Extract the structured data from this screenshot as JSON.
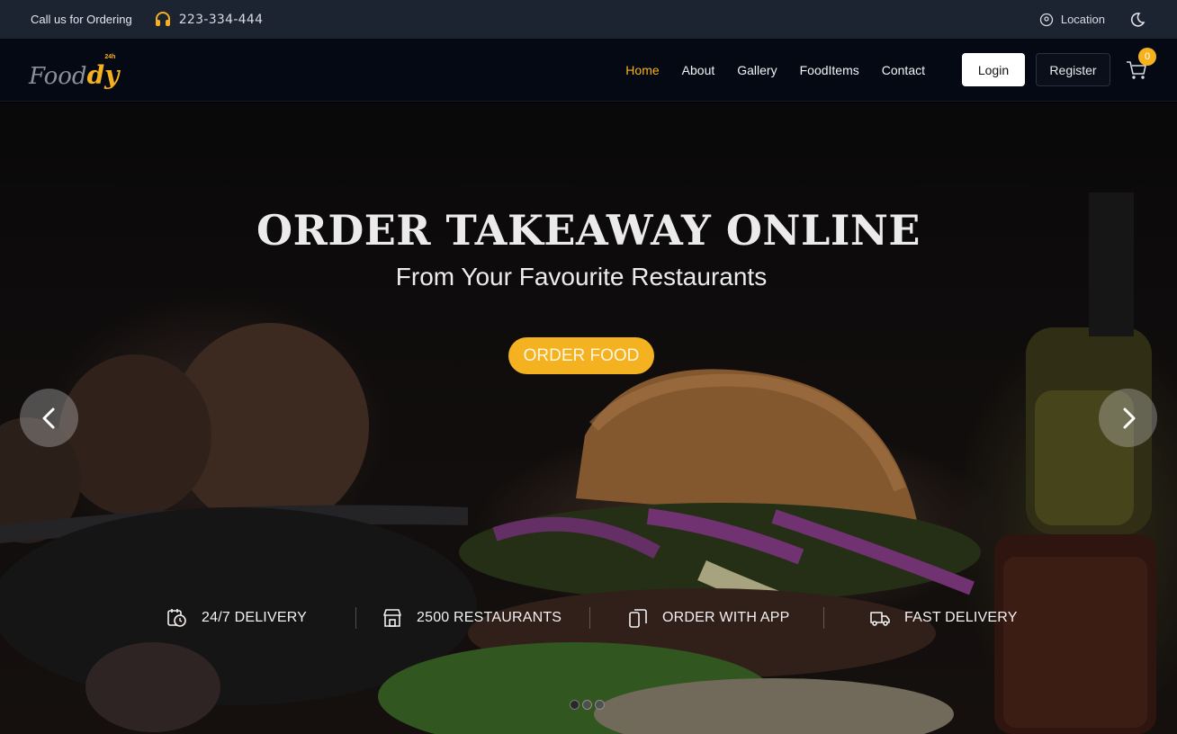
{
  "topbar": {
    "call_text": "Call us for Ordering",
    "phone": "223-334-444",
    "location_label": "Location"
  },
  "navbar": {
    "logo_main": "Food",
    "logo_accent": "dy",
    "logo_sup": "24h",
    "links": [
      {
        "label": "Home",
        "active": true
      },
      {
        "label": "About"
      },
      {
        "label": "Gallery"
      },
      {
        "label": "FoodItems"
      },
      {
        "label": "Contact"
      }
    ],
    "login_label": "Login",
    "register_label": "Register",
    "cart_count": "0"
  },
  "hero": {
    "title": "ORDER TAKEAWAY ONLINE",
    "subtitle": "From Your Favourite Restaurants",
    "cta_label": "ORDER FOOD"
  },
  "features": [
    {
      "label": "24/7 DELIVERY",
      "icon": "calendar-clock-icon"
    },
    {
      "label": "2500 RESTAURANTS",
      "icon": "store-icon"
    },
    {
      "label": "ORDER WITH APP",
      "icon": "phone-app-icon"
    },
    {
      "label": "FAST DELIVERY",
      "icon": "truck-icon"
    }
  ],
  "carousel": {
    "slides": 3,
    "active": 1
  },
  "colors": {
    "accent": "#f5b21e",
    "topbar": "#1c2331",
    "navbar": "#050914"
  }
}
